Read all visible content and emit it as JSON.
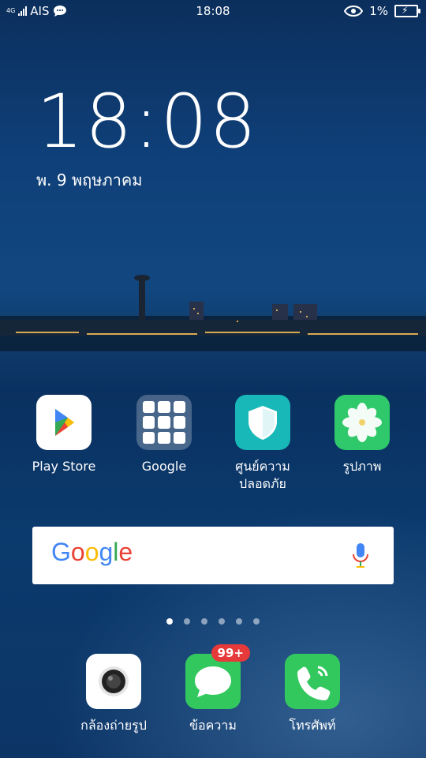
{
  "status_bar": {
    "network": "4G",
    "carrier": "AIS",
    "time": "18:08",
    "battery_percent": "1%"
  },
  "lock": {
    "clock": "18:08",
    "date": "พ. 9 พฤษภาคม"
  },
  "apps": [
    {
      "label": "Play Store",
      "icon": "play-store-icon"
    },
    {
      "label": "Google",
      "icon": "google-folder-icon"
    },
    {
      "label": "ศูนย์ความปลอดภัย",
      "icon": "security-shield-icon"
    },
    {
      "label": "รูปภาพ",
      "icon": "photos-flower-icon"
    }
  ],
  "search": {
    "logo_text": "Google"
  },
  "pages": {
    "count": 6,
    "active": 1
  },
  "dock": [
    {
      "label": "กล้องถ่ายรูป",
      "icon": "camera-icon"
    },
    {
      "label": "ข้อความ",
      "icon": "messages-icon",
      "badge": "99+"
    },
    {
      "label": "โทรศัพท์",
      "icon": "phone-icon"
    }
  ],
  "colors": {
    "badge": "#e5393a",
    "messages": "#33c85e",
    "security": "#18b8b8"
  }
}
